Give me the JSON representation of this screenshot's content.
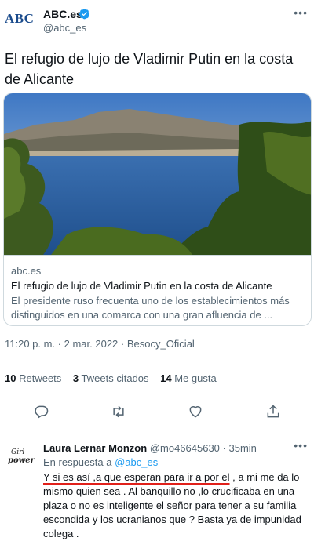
{
  "author": {
    "logo_text": "ABC",
    "display_name": "ABC.es",
    "handle": "@abc_es",
    "verified": true
  },
  "tweet": {
    "text": "El refugio de lujo de Vladimir Putin en la costa de Alicante",
    "timestamp": "11:20 p. m. · 2 mar. 2022 · Besocy_Oficial"
  },
  "card": {
    "domain": "abc.es",
    "title": "El refugio de lujo de Vladimir Putin en la costa de Alicante",
    "description": "El presidente ruso frecuenta uno de los establecimientos más distinguidos en una comarca con una gran afluencia de ..."
  },
  "stats": {
    "retweets_count": "10",
    "retweets_label": "Retweets",
    "quotes_count": "3",
    "quotes_label": "Tweets citados",
    "likes_count": "14",
    "likes_label": "Me gusta"
  },
  "actions": [
    "reply-icon",
    "retweet-icon",
    "like-icon",
    "share-icon"
  ],
  "reply": {
    "avatar_text_1": "Girl",
    "avatar_text_2": "power",
    "name": "Laura Lernar Monzon",
    "handle": "@mo46645630",
    "time": "· 35min",
    "in_reply_prefix": "En respuesta a",
    "in_reply_handle": "@abc_es",
    "text_underlined": "Y si es así ,a que esperan para ir a por el",
    "text_rest": " , a mi me da lo mismo quien sea . Al banquillo no ,lo crucificaba en una plaza o no es inteligente el señor para tener a su familia escondida y los ucranianos que ? Basta ya de impunidad colega ."
  },
  "colors": {
    "accent": "#1d9bf0",
    "text": "#0f1419",
    "secondary": "#536471",
    "underline": "#e0201a"
  }
}
